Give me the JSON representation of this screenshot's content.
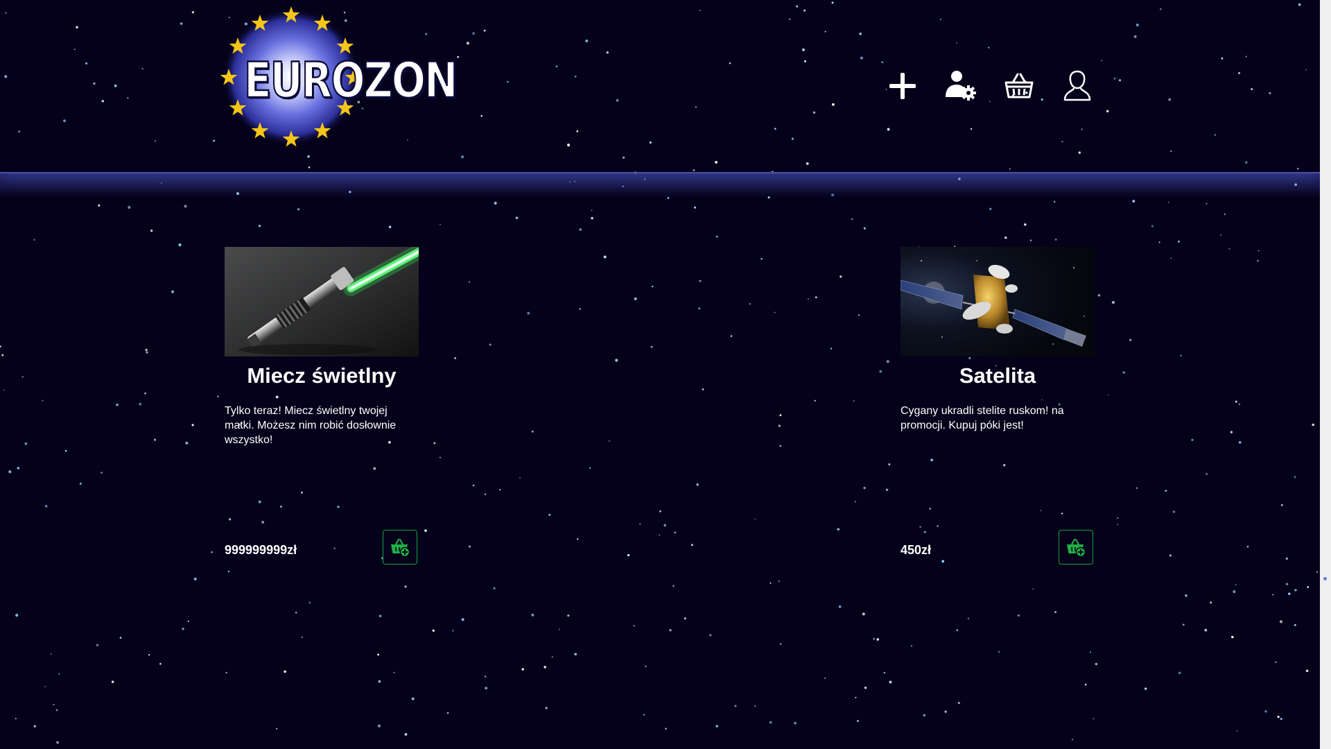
{
  "brand": {
    "logo_text": "EUROZON"
  },
  "nav": {
    "items": [
      {
        "icon": "plus-icon"
      },
      {
        "icon": "user-settings-icon"
      },
      {
        "icon": "basket-icon"
      },
      {
        "icon": "user-icon"
      }
    ]
  },
  "products": [
    {
      "title": "Miecz świetlny",
      "description": "Tylko teraz! Miecz świetlny twojej matki. Możesz nim robić dosłownie wszystko!",
      "price": "999999999zł",
      "image": "lightsaber-image",
      "cart_icon": "basket-add-icon"
    },
    {
      "title": "Satelita",
      "description": "Cygany ukradli stelite ruskom! na promocji. Kupuj póki jest!",
      "price": "450zł",
      "image": "satellite-image",
      "cart_icon": "basket-add-icon"
    }
  ],
  "colors": {
    "background": "#05011a",
    "header_line": "#4a4fa6",
    "cart_accent": "#17a53a",
    "star_gold": "#f5c518",
    "logo_globe": "#5a63d8"
  }
}
